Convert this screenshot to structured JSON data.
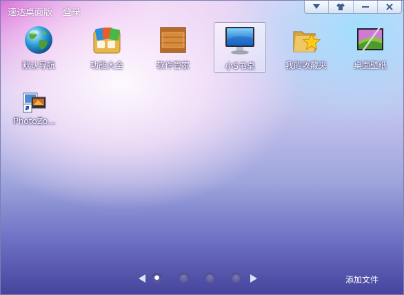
{
  "titlebar": {
    "app_title": "速达桌面版",
    "login": "登录"
  },
  "window_controls": [
    "dropdown-icon",
    "skin-icon",
    "minimize-icon",
    "close-icon"
  ],
  "apps": [
    {
      "label": "默认导航",
      "icon": "globe-icon",
      "selected": false
    },
    {
      "label": "功能大全",
      "icon": "toolbox-icon",
      "selected": false
    },
    {
      "label": "软件管家",
      "icon": "wooden-box-icon",
      "selected": false
    },
    {
      "label": "小S书桌",
      "icon": "monitor-icon",
      "selected": true
    },
    {
      "label": "我的收藏夹",
      "icon": "star-folder-icon",
      "selected": false
    },
    {
      "label": "桌面壁纸",
      "icon": "wallpaper-icon",
      "selected": false
    }
  ],
  "desktop": {
    "shortcut_label": "PhotoZo..."
  },
  "pager": {
    "pages": 4,
    "current": 1
  },
  "footer": {
    "add_file": "添加文件"
  }
}
